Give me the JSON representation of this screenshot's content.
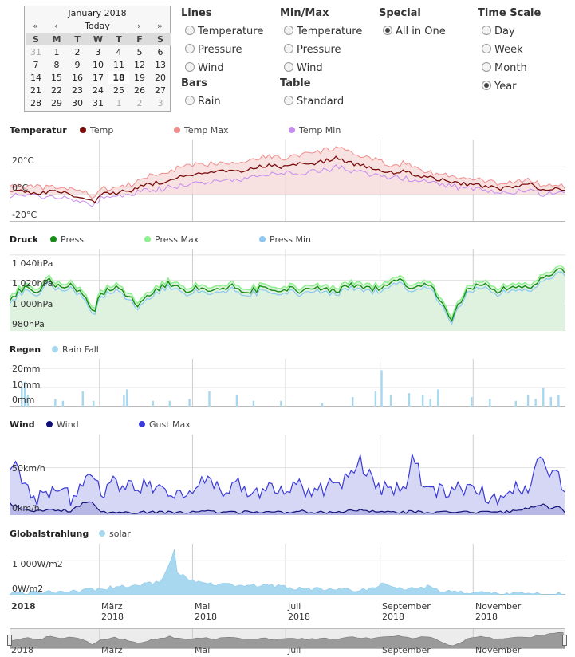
{
  "calendar": {
    "title": "January 2018",
    "prev_year": "«",
    "prev_month": "‹",
    "today": "Today",
    "next_month": "›",
    "next_year": "»",
    "weekdays": [
      "S",
      "M",
      "T",
      "W",
      "T",
      "F",
      "S"
    ],
    "weeks": [
      [
        "31",
        "1",
        "2",
        "3",
        "4",
        "5",
        "6"
      ],
      [
        "7",
        "8",
        "9",
        "10",
        "11",
        "12",
        "13"
      ],
      [
        "14",
        "15",
        "16",
        "17",
        "18",
        "19",
        "20"
      ],
      [
        "21",
        "22",
        "23",
        "24",
        "25",
        "26",
        "27"
      ],
      [
        "28",
        "29",
        "30",
        "31",
        "1",
        "2",
        "3"
      ]
    ],
    "selected": "18"
  },
  "options": {
    "lines": {
      "title": "Lines",
      "items": [
        "Temperature",
        "Pressure",
        "Wind"
      ]
    },
    "bars": {
      "title": "Bars",
      "items": [
        "Rain"
      ]
    },
    "minmax": {
      "title": "Min/Max",
      "items": [
        "Temperature",
        "Pressure",
        "Wind"
      ]
    },
    "table": {
      "title": "Table",
      "items": [
        "Standard"
      ]
    },
    "special": {
      "title": "Special",
      "items": [
        "All in One"
      ],
      "selected": "All in One"
    },
    "timescale": {
      "title": "Time Scale",
      "items": [
        "Day",
        "Week",
        "Month",
        "Year"
      ],
      "selected": "Year"
    }
  },
  "colors": {
    "temp": "#7a0c0c",
    "temp_max": "#f08c8c",
    "temp_min": "#c78cf0",
    "press": "#138d13",
    "press_max": "#8cf08c",
    "press_min": "#8cc8f0",
    "rain": "#a8d8f0",
    "wind": "#10107a",
    "gust": "#3a3ad8",
    "solar": "#a8d8f0"
  },
  "chart_data": [
    {
      "type": "line",
      "title": "Temperatur",
      "series": [
        {
          "name": "Temp",
          "key": "temp"
        },
        {
          "name": "Temp Max",
          "key": "temp_max"
        },
        {
          "name": "Temp Min",
          "key": "temp_min"
        }
      ],
      "y_ticks": [
        "20°C",
        "0°C",
        "-20°C"
      ],
      "ylim": [
        -20,
        40
      ],
      "points": [
        [
          0,
          3,
          7,
          -1
        ],
        [
          10,
          2,
          6,
          -1
        ],
        [
          20,
          1,
          5,
          -2
        ],
        [
          30,
          2,
          5,
          -1
        ],
        [
          40,
          0,
          4,
          -3
        ],
        [
          50,
          -3,
          1,
          -6
        ],
        [
          55,
          -6,
          -2,
          -9
        ],
        [
          60,
          0,
          4,
          -3
        ],
        [
          70,
          1,
          5,
          -2
        ],
        [
          80,
          3,
          7,
          0
        ],
        [
          90,
          7,
          13,
          3
        ],
        [
          100,
          9,
          15,
          4
        ],
        [
          110,
          12,
          19,
          6
        ],
        [
          120,
          14,
          21,
          8
        ],
        [
          130,
          15,
          22,
          9
        ],
        [
          140,
          17,
          24,
          11
        ],
        [
          150,
          16,
          23,
          10
        ],
        [
          160,
          19,
          26,
          13
        ],
        [
          170,
          21,
          28,
          15
        ],
        [
          180,
          20,
          26,
          15
        ],
        [
          190,
          22,
          29,
          16
        ],
        [
          200,
          23,
          30,
          17
        ],
        [
          210,
          25,
          33,
          18
        ],
        [
          215,
          27,
          35,
          20
        ],
        [
          220,
          24,
          31,
          18
        ],
        [
          230,
          21,
          28,
          16
        ],
        [
          240,
          19,
          25,
          14
        ],
        [
          250,
          16,
          21,
          12
        ],
        [
          260,
          17,
          23,
          12
        ],
        [
          270,
          13,
          18,
          9
        ],
        [
          280,
          11,
          15,
          8
        ],
        [
          290,
          9,
          13,
          6
        ],
        [
          300,
          7,
          11,
          4
        ],
        [
          310,
          6,
          10,
          3
        ],
        [
          320,
          4,
          8,
          1
        ],
        [
          330,
          5,
          9,
          2
        ],
        [
          340,
          8,
          11,
          4
        ],
        [
          350,
          3,
          6,
          0
        ],
        [
          360,
          4,
          7,
          1
        ],
        [
          364,
          3,
          6,
          0
        ]
      ]
    },
    {
      "type": "line",
      "title": "Druck",
      "series": [
        {
          "name": "Press",
          "key": "press"
        },
        {
          "name": "Press Max",
          "key": "press_max"
        },
        {
          "name": "Press Min",
          "key": "press_min"
        }
      ],
      "y_ticks": [
        "1 040hPa",
        "1 020hPa",
        "1 000hPa",
        "980hPa"
      ],
      "ylim": [
        980,
        1045
      ],
      "points": [
        [
          0,
          1005
        ],
        [
          10,
          1015
        ],
        [
          20,
          1010
        ],
        [
          25,
          1020
        ],
        [
          35,
          1012
        ],
        [
          40,
          1016
        ],
        [
          50,
          1008
        ],
        [
          55,
          995
        ],
        [
          60,
          1010
        ],
        [
          70,
          1015
        ],
        [
          80,
          1005
        ],
        [
          85,
          1000
        ],
        [
          95,
          1012
        ],
        [
          105,
          1018
        ],
        [
          115,
          1010
        ],
        [
          125,
          1015
        ],
        [
          135,
          1012
        ],
        [
          145,
          1016
        ],
        [
          155,
          1010
        ],
        [
          165,
          1014
        ],
        [
          175,
          1010
        ],
        [
          185,
          1013
        ],
        [
          195,
          1011
        ],
        [
          205,
          1014
        ],
        [
          215,
          1012
        ],
        [
          225,
          1016
        ],
        [
          235,
          1013
        ],
        [
          245,
          1015
        ],
        [
          255,
          1020
        ],
        [
          265,
          1014
        ],
        [
          275,
          1018
        ],
        [
          285,
          1000
        ],
        [
          290,
          990
        ],
        [
          300,
          1012
        ],
        [
          310,
          1018
        ],
        [
          320,
          1010
        ],
        [
          330,
          1016
        ],
        [
          340,
          1014
        ],
        [
          350,
          1022
        ],
        [
          360,
          1030
        ],
        [
          364,
          1028
        ]
      ]
    },
    {
      "type": "bar",
      "title": "Regen",
      "series": [
        {
          "name": "Rain Fall",
          "key": "rain"
        }
      ],
      "y_ticks": [
        "20mm",
        "10mm",
        "0mm"
      ],
      "ylim": [
        0,
        25
      ],
      "points": [
        [
          8,
          10
        ],
        [
          10,
          13
        ],
        [
          12,
          6
        ],
        [
          30,
          4
        ],
        [
          35,
          3
        ],
        [
          48,
          8
        ],
        [
          55,
          3
        ],
        [
          75,
          6
        ],
        [
          77,
          9
        ],
        [
          94,
          3
        ],
        [
          105,
          3
        ],
        [
          118,
          4
        ],
        [
          131,
          8
        ],
        [
          149,
          6
        ],
        [
          160,
          3
        ],
        [
          178,
          3
        ],
        [
          205,
          2
        ],
        [
          225,
          5
        ],
        [
          240,
          8
        ],
        [
          244,
          19
        ],
        [
          250,
          6
        ],
        [
          262,
          7
        ],
        [
          271,
          6
        ],
        [
          276,
          4
        ],
        [
          281,
          9
        ],
        [
          303,
          5
        ],
        [
          315,
          4
        ],
        [
          332,
          3
        ],
        [
          340,
          6
        ],
        [
          345,
          4
        ],
        [
          350,
          10
        ],
        [
          355,
          5
        ],
        [
          360,
          6
        ]
      ]
    },
    {
      "type": "area",
      "title": "Wind",
      "series": [
        {
          "name": "Wind",
          "key": "wind"
        },
        {
          "name": "Gust Max",
          "key": "gust"
        }
      ],
      "y_ticks": [
        "50km/h",
        "0km/h"
      ],
      "ylim": [
        0,
        85
      ],
      "points": [
        [
          0,
          12,
          55
        ],
        [
          4,
          10,
          62
        ],
        [
          8,
          6,
          30
        ],
        [
          15,
          4,
          20
        ],
        [
          20,
          5,
          18
        ],
        [
          28,
          5,
          22
        ],
        [
          35,
          5,
          25
        ],
        [
          40,
          4,
          18
        ],
        [
          50,
          14,
          35
        ],
        [
          55,
          12,
          45
        ],
        [
          60,
          3,
          25
        ],
        [
          70,
          3,
          35
        ],
        [
          80,
          3,
          30
        ],
        [
          90,
          3,
          32
        ],
        [
          100,
          3,
          28
        ],
        [
          110,
          3,
          22
        ],
        [
          120,
          3,
          30
        ],
        [
          130,
          4,
          40
        ],
        [
          140,
          3,
          24
        ],
        [
          150,
          3,
          30
        ],
        [
          160,
          3,
          26
        ],
        [
          170,
          3,
          28
        ],
        [
          180,
          3,
          24
        ],
        [
          190,
          4,
          32
        ],
        [
          200,
          3,
          22
        ],
        [
          210,
          3,
          30
        ],
        [
          220,
          4,
          35
        ],
        [
          230,
          5,
          55
        ],
        [
          240,
          3,
          30
        ],
        [
          250,
          3,
          26
        ],
        [
          260,
          3,
          24
        ],
        [
          265,
          4,
          70
        ],
        [
          270,
          3,
          30
        ],
        [
          280,
          3,
          24
        ],
        [
          290,
          3,
          28
        ],
        [
          300,
          3,
          26
        ],
        [
          310,
          3,
          22
        ],
        [
          320,
          3,
          20
        ],
        [
          330,
          4,
          28
        ],
        [
          340,
          8,
          30
        ],
        [
          350,
          12,
          65
        ],
        [
          355,
          6,
          40
        ],
        [
          360,
          8,
          52
        ],
        [
          364,
          4,
          20
        ]
      ]
    },
    {
      "type": "area",
      "title": "Globalstrahlung",
      "series": [
        {
          "name": "solar",
          "key": "solar"
        }
      ],
      "y_ticks": [
        "1 000W/m2",
        "0W/m2"
      ],
      "ylim": [
        0,
        1500
      ],
      "points": [
        [
          0,
          30
        ],
        [
          20,
          80
        ],
        [
          40,
          120
        ],
        [
          60,
          180
        ],
        [
          75,
          250
        ],
        [
          90,
          300
        ],
        [
          100,
          450
        ],
        [
          105,
          900
        ],
        [
          108,
          1300
        ],
        [
          110,
          700
        ],
        [
          115,
          500
        ],
        [
          125,
          350
        ],
        [
          140,
          300
        ],
        [
          155,
          250
        ],
        [
          170,
          300
        ],
        [
          185,
          200
        ],
        [
          200,
          180
        ],
        [
          215,
          150
        ],
        [
          230,
          120
        ],
        [
          240,
          250
        ],
        [
          245,
          350
        ],
        [
          250,
          200
        ],
        [
          260,
          150
        ],
        [
          270,
          180
        ],
        [
          275,
          260
        ],
        [
          280,
          150
        ],
        [
          290,
          80
        ],
        [
          300,
          60
        ],
        [
          320,
          40
        ],
        [
          340,
          30
        ],
        [
          364,
          20
        ]
      ]
    }
  ],
  "x_axis": {
    "year_label": "2018",
    "months": [
      {
        "name": "März",
        "year": "2018"
      },
      {
        "name": "Mai",
        "year": "2018"
      },
      {
        "name": "Juli",
        "year": "2018"
      },
      {
        "name": "September",
        "year": "2018"
      },
      {
        "name": "November",
        "year": "2018"
      }
    ]
  },
  "navigator": {
    "labels": [
      "2018",
      "März",
      "Mai",
      "Juli",
      "September",
      "November"
    ]
  }
}
